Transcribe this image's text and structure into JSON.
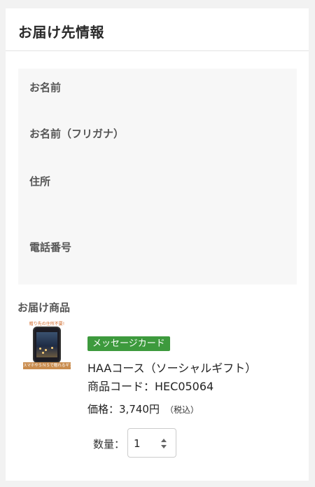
{
  "section": {
    "title": "お届け先情報"
  },
  "recipient": {
    "name_label": "お名前",
    "kana_label": "お名前（フリガナ）",
    "address_label": "住所",
    "phone_label": "電話番号"
  },
  "items": {
    "title": "お届け商品",
    "product": {
      "image_top_text": "贈り先の住所不要!",
      "image_banner_text": "スマホやＳＮＳで贈れるギフト",
      "badge": "メッセージカード",
      "name": "HAAコース（ソーシャルギフト）",
      "code": "商品コード：HEC05064",
      "price_label": "価格：",
      "price_value": "3,740円",
      "tax_note": "（税込）",
      "quantity_label": "数量：",
      "quantity_value": "1"
    }
  },
  "colors": {
    "badge": "#3d9a3d",
    "page_background": "#f2f2f2",
    "info_box_background": "#f7f7f7"
  },
  "icons": {
    "quantity_toggle": "updown-icon"
  }
}
